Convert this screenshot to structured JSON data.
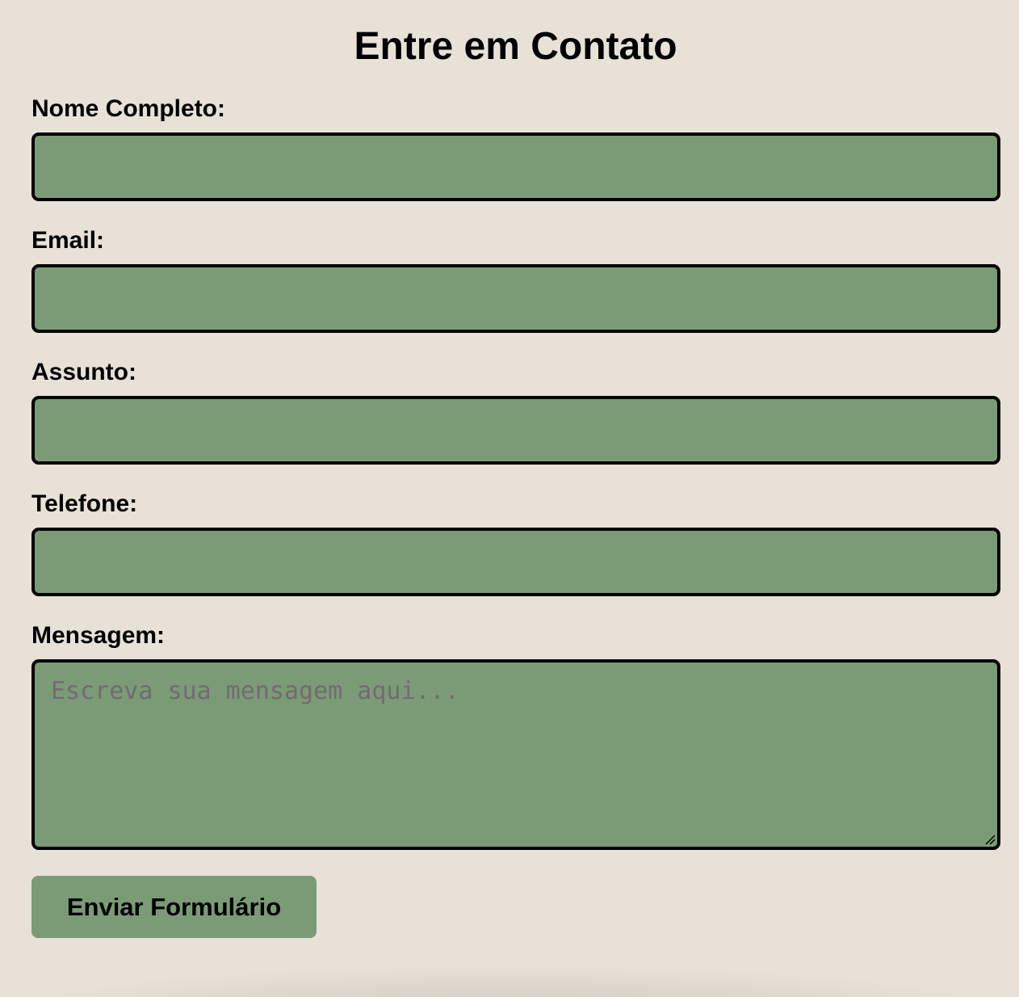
{
  "form": {
    "title": "Entre em Contato",
    "fields": [
      {
        "label": "Nome Completo:",
        "value": "",
        "placeholder": ""
      },
      {
        "label": "Email:",
        "value": "",
        "placeholder": ""
      },
      {
        "label": "Assunto:",
        "value": "",
        "placeholder": ""
      },
      {
        "label": "Telefone:",
        "value": "",
        "placeholder": ""
      }
    ],
    "message": {
      "label": "Mensagem:",
      "value": "",
      "placeholder": "Escreva sua mensagem aqui..."
    },
    "submit_label": "Enviar Formulário"
  },
  "icons": {
    "textarea_resize": "resize-handle-icon"
  },
  "colors": {
    "background": "#e8e1d8",
    "field_fill": "#7b9b76",
    "field_border": "#000000",
    "placeholder_text": "#726b70"
  }
}
